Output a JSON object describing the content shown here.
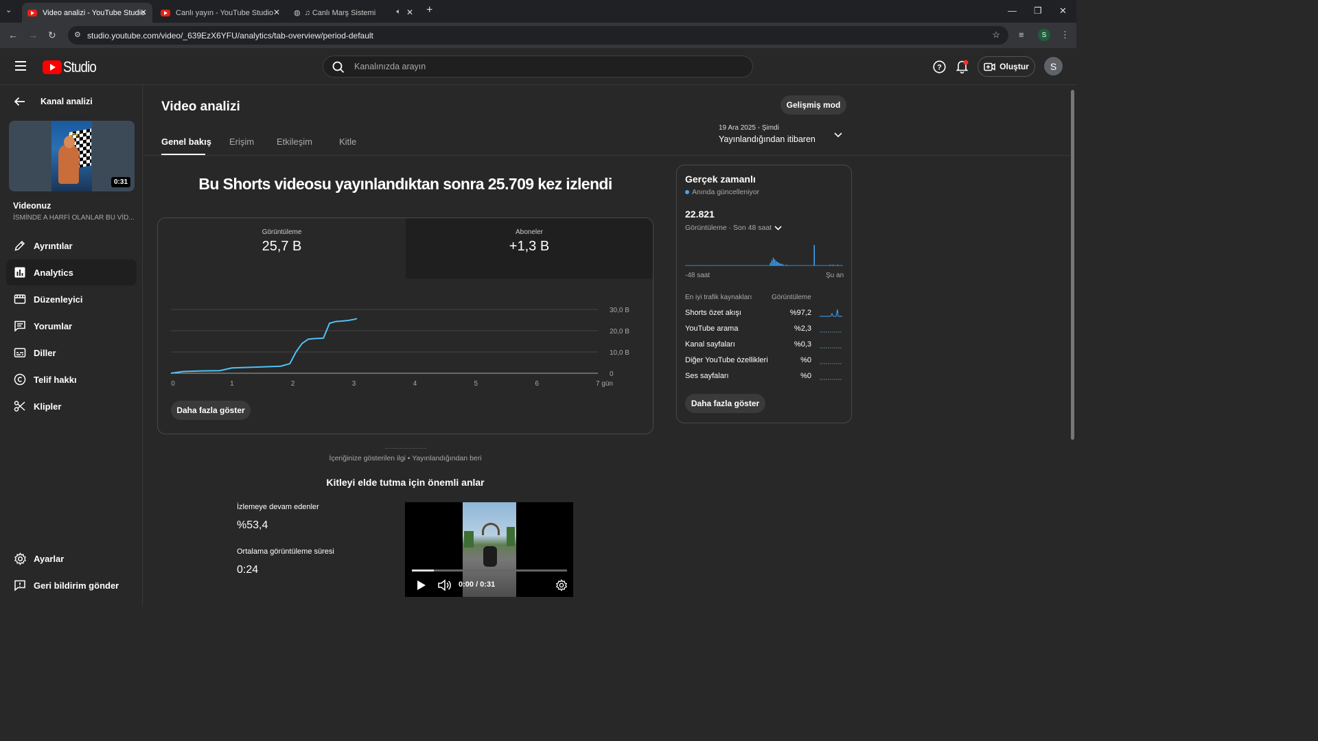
{
  "browser": {
    "tabs": [
      {
        "title": "Video analizi - YouTube Studio",
        "active": true
      },
      {
        "title": "Canlı yayın - YouTube Studio",
        "active": false
      },
      {
        "title": "Canlı Marş Sistemi",
        "active": false
      }
    ],
    "url": "studio.youtube.com/video/_639EzX6YFU/analytics/tab-overview/period-default",
    "profile_initial": "S"
  },
  "header": {
    "logo_text": "Studio",
    "search_placeholder": "Kanalınızda arayın",
    "create_label": "Oluştur",
    "avatar_initial": "S"
  },
  "sidebar": {
    "back_label": "Kanal analizi",
    "video_duration": "0:31",
    "video_section_title": "Videonuz",
    "video_title": "İSMİNDE A HARFİ OLANLAR BU VİD...",
    "items": [
      {
        "label": "Ayrıntılar",
        "icon": "pencil-icon",
        "active": false
      },
      {
        "label": "Analytics",
        "icon": "analytics-icon",
        "active": true
      },
      {
        "label": "Düzenleyici",
        "icon": "editor-icon",
        "active": false
      },
      {
        "label": "Yorumlar",
        "icon": "comments-icon",
        "active": false
      },
      {
        "label": "Diller",
        "icon": "subtitles-icon",
        "active": false
      },
      {
        "label": "Telif hakkı",
        "icon": "copyright-icon",
        "active": false
      },
      {
        "label": "Klipler",
        "icon": "scissors-icon",
        "active": false
      }
    ],
    "bottom_items": [
      {
        "label": "Ayarlar",
        "icon": "gear-icon"
      },
      {
        "label": "Geri bildirim gönder",
        "icon": "feedback-icon"
      }
    ]
  },
  "main": {
    "page_title": "Video analizi",
    "advanced_mode": "Gelişmiş mod",
    "tabs": [
      "Genel bakış",
      "Erişim",
      "Etkileşim",
      "Kitle"
    ],
    "date_range": {
      "top": "19 Ara 2025 - Şimdi",
      "bottom": "Yayınlandığından itibaren"
    },
    "headline": "Bu Shorts videosu yayınlandıktan sonra 25.709 kez izlendi",
    "metrics": [
      {
        "label": "Görüntüleme",
        "value": "25,7 B"
      },
      {
        "label": "Aboneler",
        "value": "+1,3 B"
      }
    ],
    "show_more": "Daha fazla göster",
    "interest_caption": "İçeriğinize gösterilen ilgi • Yayınlandığından beri",
    "retention_title": "Kitleyi elde tutma için önemli anlar",
    "retention": [
      {
        "label": "İzlemeye devam edenler",
        "value": "%53,4"
      },
      {
        "label": "Ortalama görüntüleme süresi",
        "value": "0:24"
      }
    ],
    "player_time": "0:00 / 0:31"
  },
  "chart_data": {
    "type": "line",
    "x": [
      0,
      0.2,
      0.5,
      0.8,
      1.0,
      1.5,
      1.8,
      1.95,
      2.05,
      2.15,
      2.25,
      2.35,
      2.5,
      2.6,
      2.7,
      2.8,
      2.9,
      3.0,
      3.05
    ],
    "values": [
      0,
      0.8,
      1.1,
      1.2,
      2.5,
      3.0,
      3.3,
      4.5,
      10,
      14,
      16,
      16.3,
      16.5,
      23.5,
      24.3,
      24.5,
      24.8,
      25.3,
      25.7
    ],
    "xticks": [
      "0",
      "1",
      "2",
      "3",
      "4",
      "5",
      "6",
      "7 gün"
    ],
    "yticks": [
      "30,0 B",
      "20,0 B",
      "10,0 B",
      "0"
    ],
    "xlim": [
      0,
      7
    ],
    "ylim": [
      0,
      30
    ],
    "color": "#4fc3f7"
  },
  "realtime": {
    "title": "Gerçek zamanlı",
    "status": "Anında güncelleniyor",
    "value": "22.821",
    "caption": "Görüntüleme · Son 48 saat",
    "axis_left": "-48 saat",
    "axis_right": "Şu an",
    "bars": [
      0,
      0,
      0,
      0,
      0,
      0,
      0,
      0,
      0,
      0,
      0,
      0,
      0,
      0,
      0,
      0,
      0,
      0,
      0,
      0,
      0,
      0,
      0,
      0,
      0,
      0,
      0,
      0,
      0,
      0,
      0,
      0,
      0,
      0,
      0,
      0,
      0,
      0,
      0,
      0,
      0,
      0,
      0,
      0,
      0,
      0,
      0,
      0,
      0,
      0,
      0,
      0,
      0,
      0,
      0,
      0,
      0,
      0,
      3,
      6,
      9,
      7,
      5,
      4,
      3,
      2,
      2,
      1,
      0,
      1,
      0,
      0,
      0,
      0,
      0,
      0,
      0,
      0,
      0,
      0,
      0,
      0,
      0,
      0,
      0,
      0,
      0,
      0,
      24,
      0,
      0,
      0,
      0,
      0,
      0,
      0,
      0,
      0,
      0,
      1,
      0,
      1,
      0,
      0,
      1,
      0,
      0,
      0
    ],
    "traffic_header": {
      "source": "En iyi trafik kaynakları",
      "views": "Görüntüleme"
    },
    "traffic": [
      {
        "source": "Shorts özet akışı",
        "value": "%97,2"
      },
      {
        "source": "YouTube arama",
        "value": "%2,3"
      },
      {
        "source": "Kanal sayfaları",
        "value": "%0,3"
      },
      {
        "source": "Diğer YouTube özellikleri",
        "value": "%0"
      },
      {
        "source": "Ses sayfaları",
        "value": "%0"
      }
    ],
    "show_more": "Daha fazla göster"
  }
}
